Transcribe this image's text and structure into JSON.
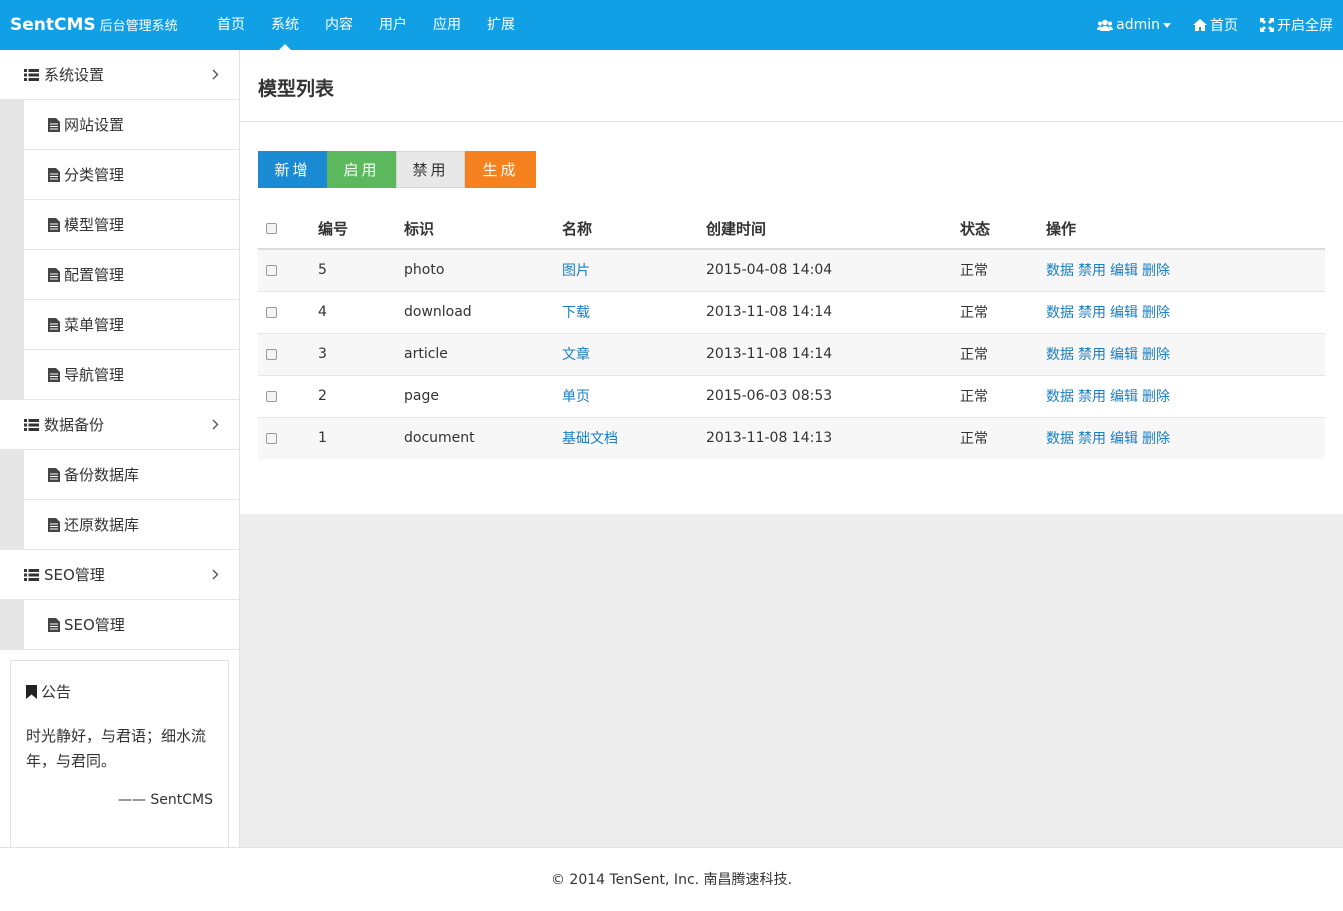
{
  "header": {
    "brand_main": "SentCMS",
    "brand_sub": "后台管理系统",
    "nav": [
      {
        "label": "首页"
      },
      {
        "label": "系统"
      },
      {
        "label": "内容"
      },
      {
        "label": "用户"
      },
      {
        "label": "应用"
      },
      {
        "label": "扩展"
      }
    ],
    "active_nav": "系统",
    "user": "admin",
    "home": "首页",
    "fullscreen": "开启全屏",
    "bg_color": "#11a0e6"
  },
  "sidebar": {
    "groups": [
      {
        "label": "系统设置",
        "items": [
          "网站设置",
          "分类管理",
          "模型管理",
          "配置管理",
          "菜单管理",
          "导航管理"
        ]
      },
      {
        "label": "数据备份",
        "items": [
          "备份数据库",
          "还原数据库"
        ]
      },
      {
        "label": "SEO管理",
        "items": [
          "SEO管理"
        ]
      }
    ],
    "notice": {
      "title": "公告",
      "text": "时光静好，与君语；细水流年，与君同。",
      "sign": "—— SentCMS"
    }
  },
  "main": {
    "title": "模型列表",
    "buttons": {
      "add": "新增",
      "enable": "启用",
      "disable": "禁用",
      "generate": "生成"
    },
    "table": {
      "headers": [
        "编号",
        "标识",
        "名称",
        "创建时间",
        "状态",
        "操作"
      ],
      "rows": [
        {
          "id": "5",
          "ident": "photo",
          "name": "图片",
          "created": "2015-04-08 14:04",
          "status": "正常"
        },
        {
          "id": "4",
          "ident": "download",
          "name": "下载",
          "created": "2013-11-08 14:14",
          "status": "正常"
        },
        {
          "id": "3",
          "ident": "article",
          "name": "文章",
          "created": "2013-11-08 14:14",
          "status": "正常"
        },
        {
          "id": "2",
          "ident": "page",
          "name": "单页",
          "created": "2015-06-03 08:53",
          "status": "正常"
        },
        {
          "id": "1",
          "ident": "document",
          "name": "基础文档",
          "created": "2013-11-08 14:13",
          "status": "正常"
        }
      ],
      "ops": [
        "数据",
        "禁用",
        "编辑",
        "删除"
      ]
    }
  },
  "footer": {
    "text": "© 2014 TenSent, Inc. 南昌腾速科技."
  }
}
